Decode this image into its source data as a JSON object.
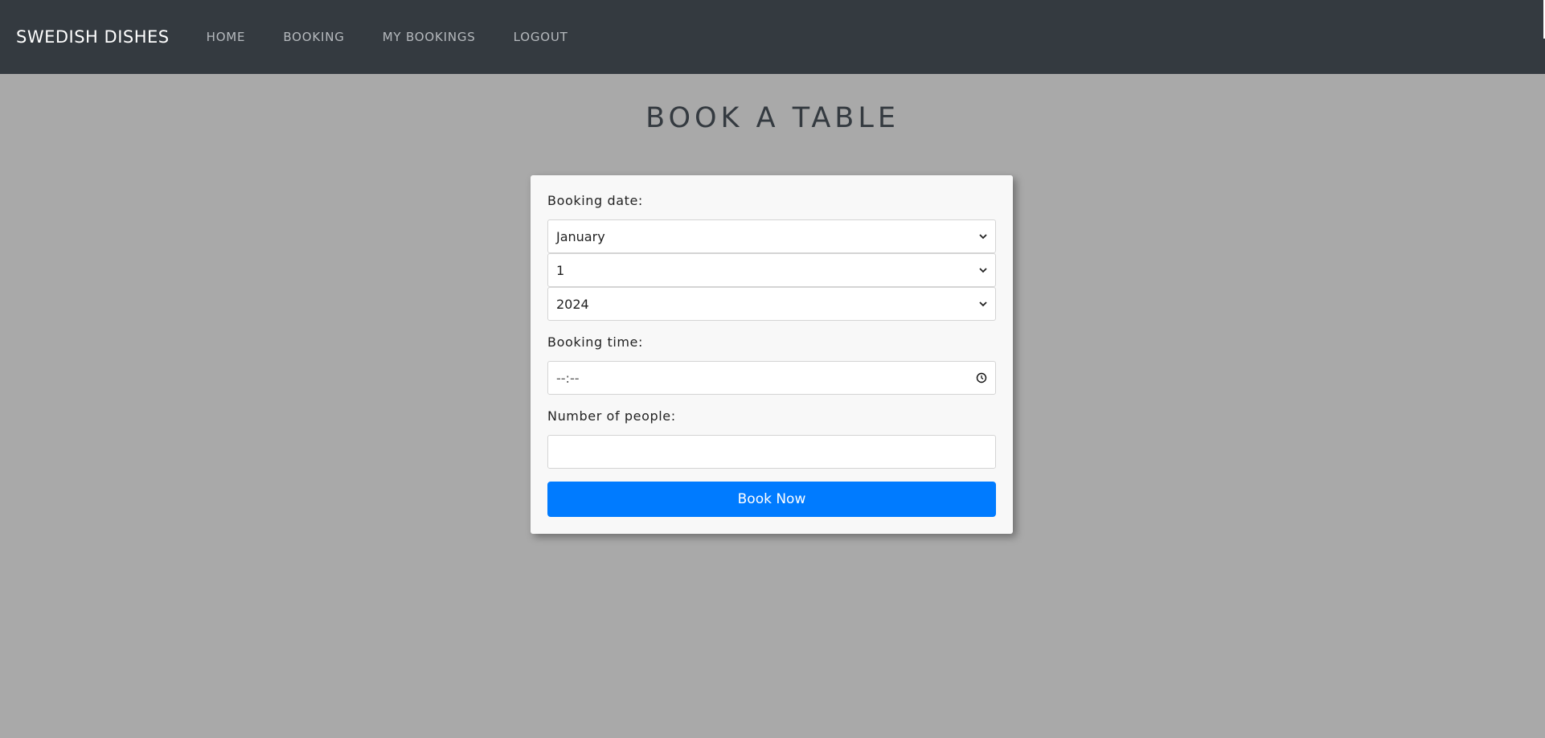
{
  "nav": {
    "brand": "SWEDISH DISHES",
    "items": [
      "HOME",
      "BOOKING",
      "MY BOOKINGS",
      "LOGOUT"
    ]
  },
  "page": {
    "title": "BOOK A TABLE"
  },
  "form": {
    "date_label": "Booking date:",
    "month_value": "January",
    "day_value": "1",
    "year_value": "2024",
    "time_label": "Booking time:",
    "time_value": "--:--",
    "people_label": "Number of people:",
    "people_value": "",
    "submit_label": "Book Now"
  },
  "colors": {
    "navbar": "#343a40",
    "background": "#a9a9a9",
    "card": "#f8f8f8",
    "primary_button": "#007bff"
  },
  "icons": {
    "select_arrow": "chevron-down-icon",
    "time_picker": "clock-icon"
  }
}
